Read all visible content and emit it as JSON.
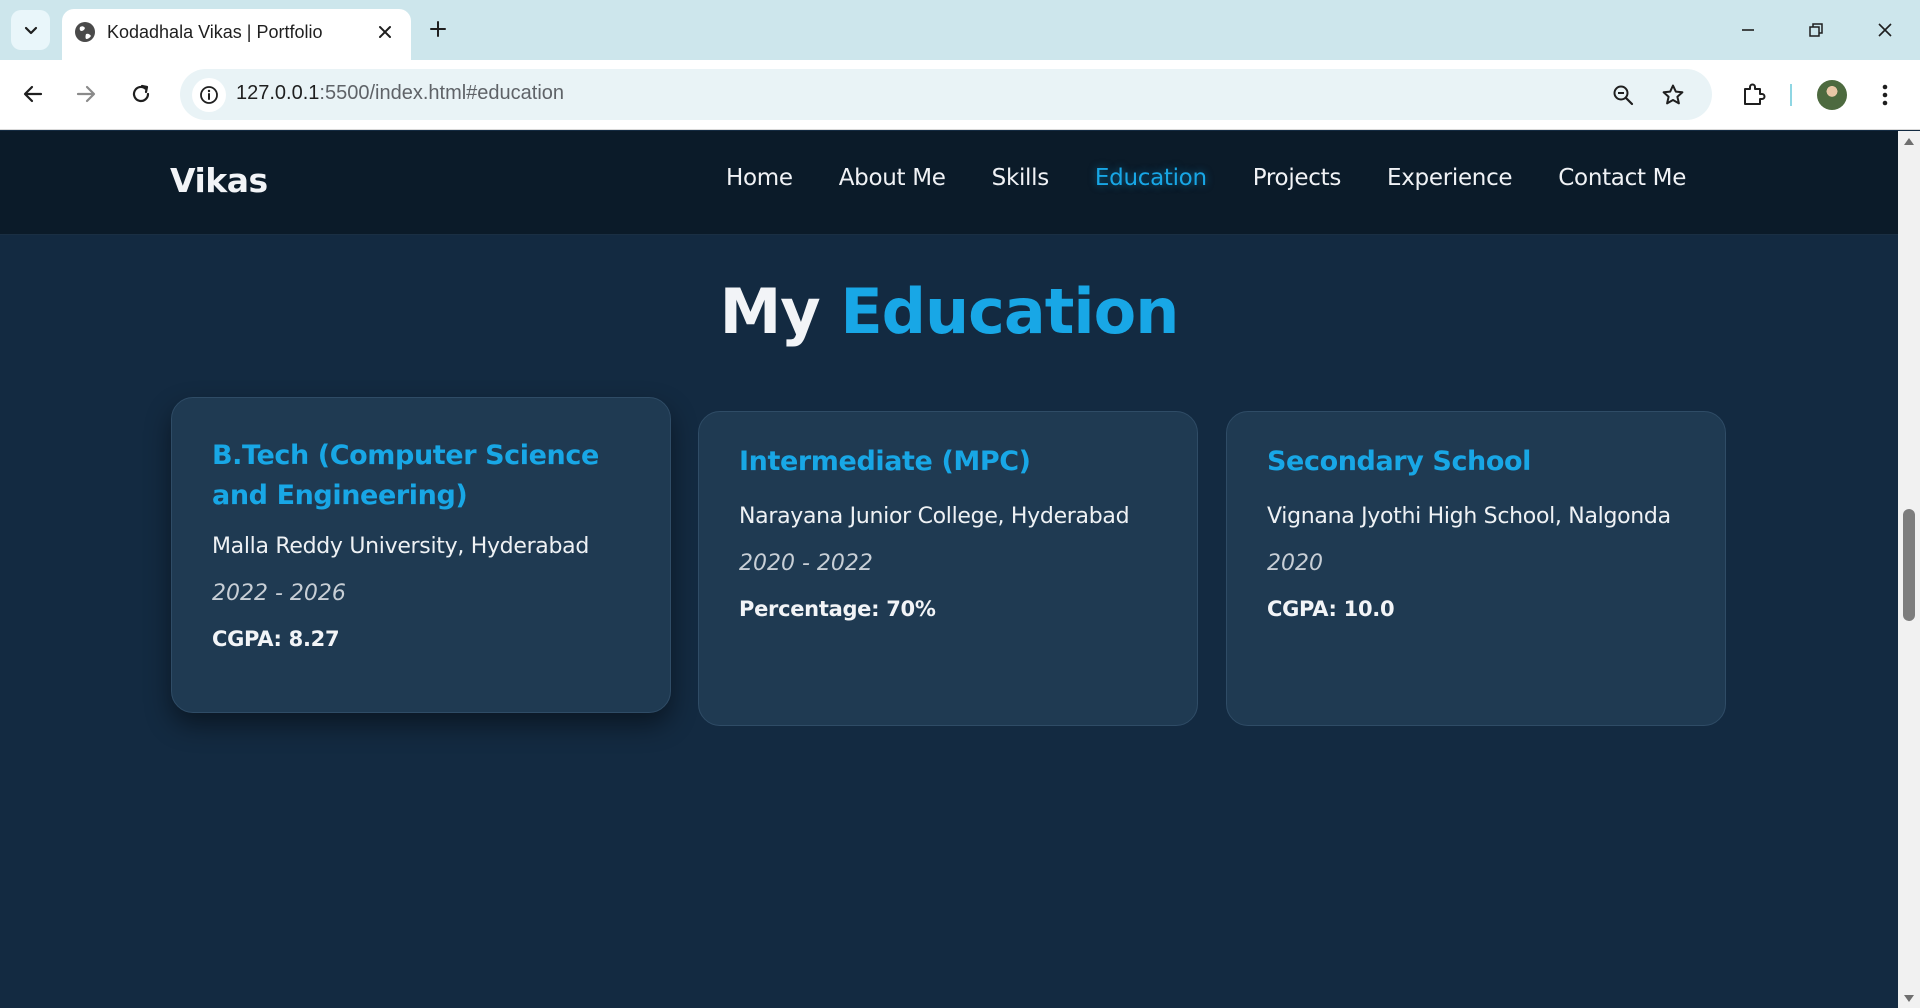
{
  "browser": {
    "tab_title": "Kodadhala Vikas | Portfolio",
    "url_host": "127.0.0.1",
    "url_path": ":5500/index.html#education"
  },
  "site": {
    "brand": "Vikas",
    "nav": [
      {
        "label": "Home"
      },
      {
        "label": "About Me"
      },
      {
        "label": "Skills"
      },
      {
        "label": "Education",
        "active": true
      },
      {
        "label": "Projects"
      },
      {
        "label": "Experience"
      },
      {
        "label": "Contact Me"
      }
    ],
    "accent_color": "#18a7e6"
  },
  "education": {
    "title_lead": "My",
    "title_accent": "Education",
    "cards": [
      {
        "degree_line1": "B.Tech (Computer Science",
        "degree_line2": "and Engineering)",
        "institution": "Malla Reddy University, Hyderabad",
        "years": "2022 - 2026",
        "score": "CGPA: 8.27"
      },
      {
        "degree_line1": "Intermediate (MPC)",
        "institution": "Narayana Junior College, Hyderabad",
        "years": "2020 - 2022",
        "score": "Percentage: 70%"
      },
      {
        "degree_line1": "Secondary School",
        "institution": "Vignana Jyothi High School, Nalgonda",
        "years": "2020",
        "score": "CGPA: 10.0"
      }
    ]
  }
}
